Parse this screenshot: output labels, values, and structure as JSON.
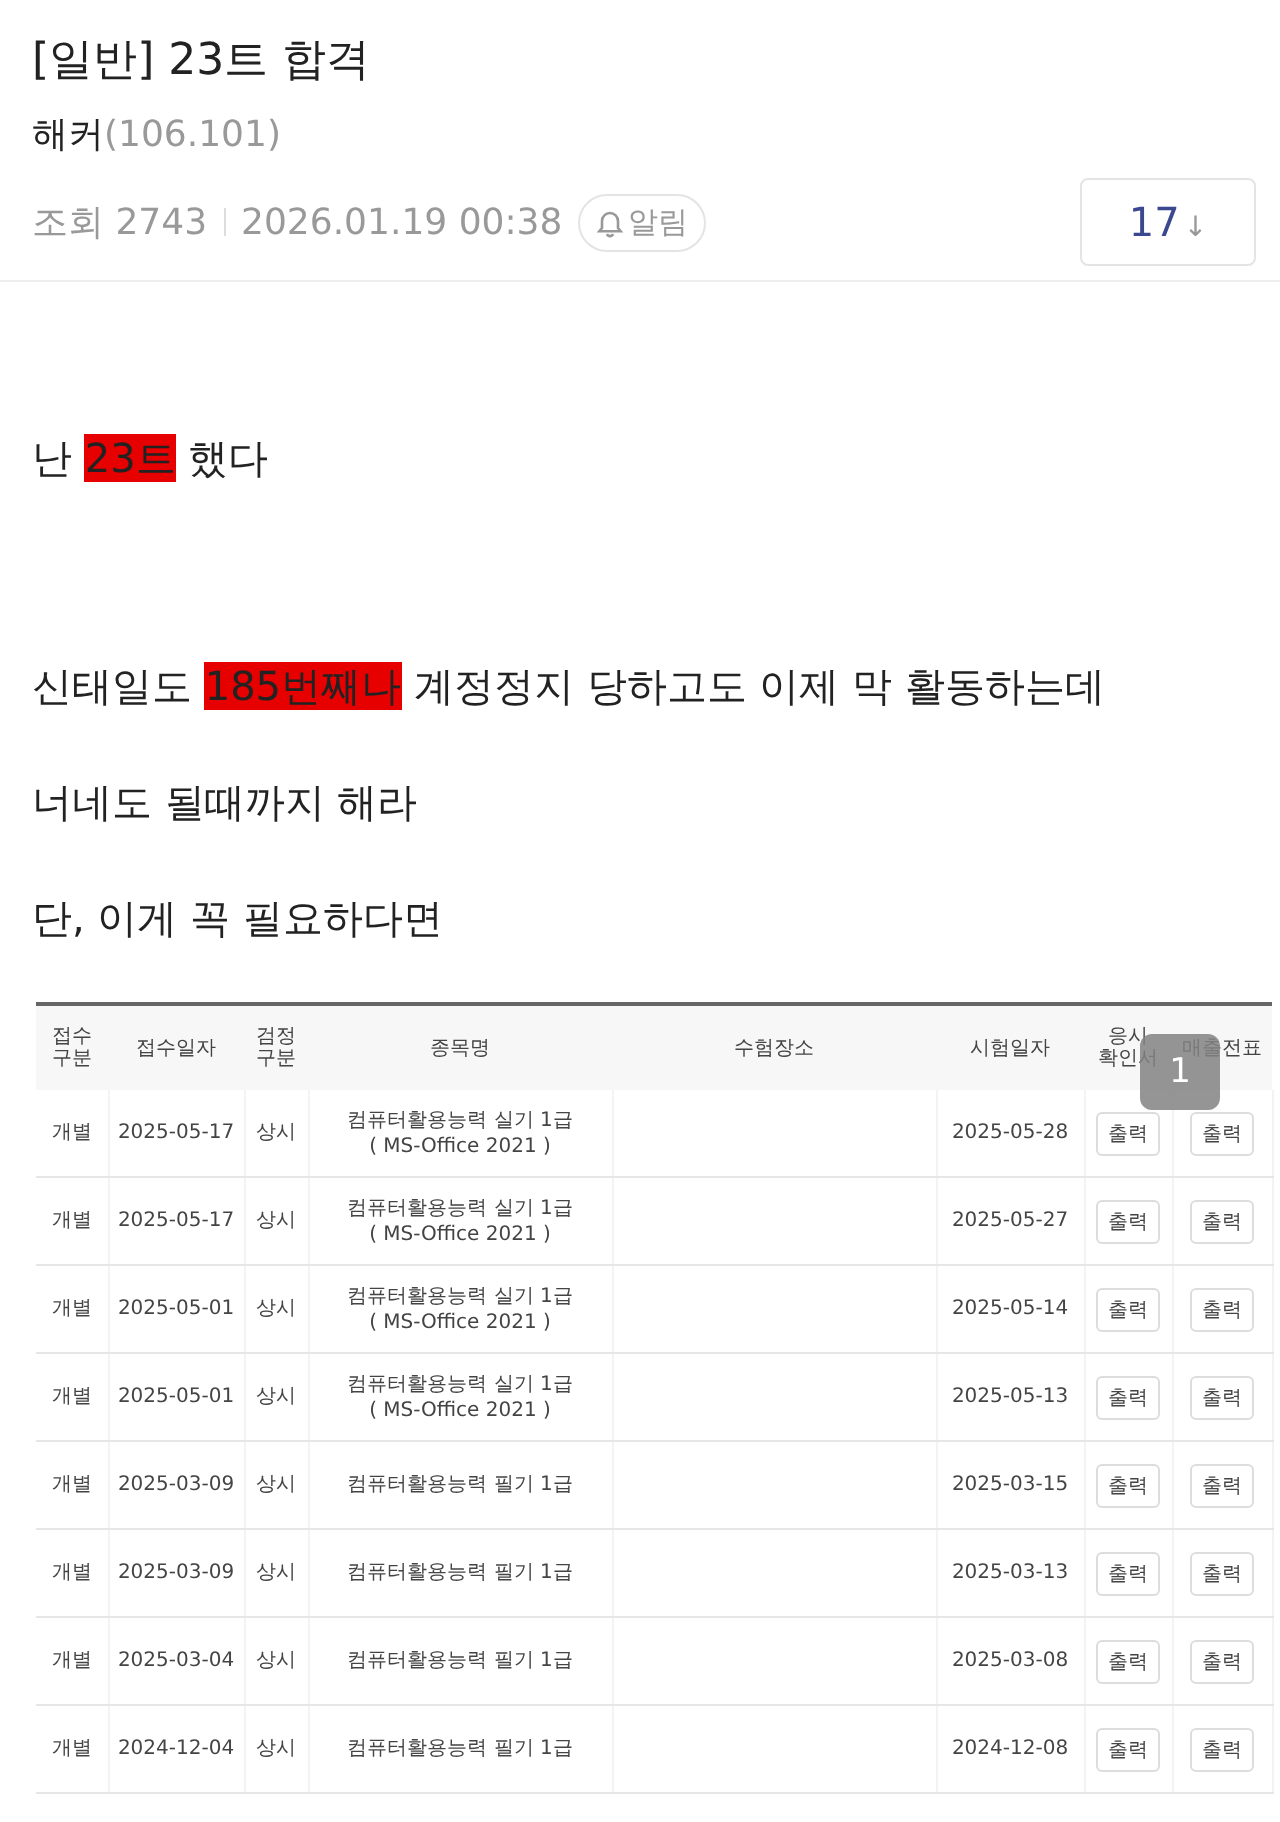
{
  "post": {
    "category": "[일반]",
    "title": "23트 합격",
    "author": "해커",
    "author_ip": "(106.101)",
    "views": "조회 2743",
    "datetime": "2026.01.19 00:38",
    "alarm_label": "알림",
    "comment_count": "17",
    "comment_arrow": "↓"
  },
  "paragraphs": [
    {
      "segments": [
        {
          "text": "난 ",
          "highlighted": false
        },
        {
          "text": "23트",
          "highlighted": true
        },
        {
          "text": " 했다",
          "highlighted": false
        }
      ]
    },
    {
      "segments": [
        {
          "text": "신태일도 ",
          "highlighted": false
        },
        {
          "text": "185번째나",
          "highlighted": true
        },
        {
          "text": " 계정정지 당하고도 이제 막 활동하는데",
          "highlighted": false
        }
      ]
    },
    {
      "segments": [
        {
          "text": "너네도 될때까지 해라",
          "highlighted": false
        }
      ]
    },
    {
      "segments": [
        {
          "text": "단, 이게 꼭 필요하다면",
          "highlighted": false
        }
      ]
    }
  ],
  "table": {
    "columns": [
      "접수\n구분",
      "접수일자",
      "검정\n구분",
      "종목명",
      "수험장소",
      "시험일자",
      "응시\n확인서",
      "매출전표"
    ],
    "rows": [
      {
        "type": "개별",
        "received": "2025-05-17",
        "exam_kind": "상시",
        "subject": "컴퓨터활용능력 실기 1급",
        "subject_detail": "( MS-Office 2021 )",
        "exam_date": "2025-05-28",
        "button_1": "출력",
        "button_2": "출력"
      },
      {
        "type": "개별",
        "received": "2025-05-17",
        "exam_kind": "상시",
        "subject": "컴퓨터활용능력 실기 1급",
        "subject_detail": "( MS-Office 2021 )",
        "exam_date": "2025-05-27",
        "button_1": "출력",
        "button_2": "출력"
      },
      {
        "type": "개별",
        "received": "2025-05-01",
        "exam_kind": "상시",
        "subject": "컴퓨터활용능력 실기 1급",
        "subject_detail": "( MS-Office 2021 )",
        "exam_date": "2025-05-14",
        "button_1": "출력",
        "button_2": "출력"
      },
      {
        "type": "개별",
        "received": "2025-05-01",
        "exam_kind": "상시",
        "subject": "컴퓨터활용능력 실기 1급",
        "subject_detail": "( MS-Office 2021 )",
        "exam_date": "2025-05-13",
        "button_1": "출력",
        "button_2": "출력"
      },
      {
        "type": "개별",
        "received": "2025-03-09",
        "exam_kind": "상시",
        "subject": "컴퓨터활용능력 필기 1급",
        "exam_date": "2025-03-15",
        "button_1": "출력",
        "button_2": "출력"
      },
      {
        "type": "개별",
        "received": "2025-03-09",
        "exam_kind": "상시",
        "subject": "컴퓨터활용능력 필기 1급",
        "exam_date": "2025-03-13",
        "button_1": "출력",
        "button_2": "출력"
      },
      {
        "type": "개별",
        "received": "2025-03-04",
        "exam_kind": "상시",
        "subject": "컴퓨터활용능력 필기 1급",
        "exam_date": "2025-03-08",
        "button_1": "출력",
        "button_2": "출력"
      },
      {
        "type": "개별",
        "received": "2024-12-04",
        "exam_kind": "상시",
        "subject": "컴퓨터활용능력 필기 1급",
        "exam_date": "2024-12-08",
        "button_1": "출력",
        "button_2": "출력"
      }
    ]
  },
  "image_badge": "1"
}
